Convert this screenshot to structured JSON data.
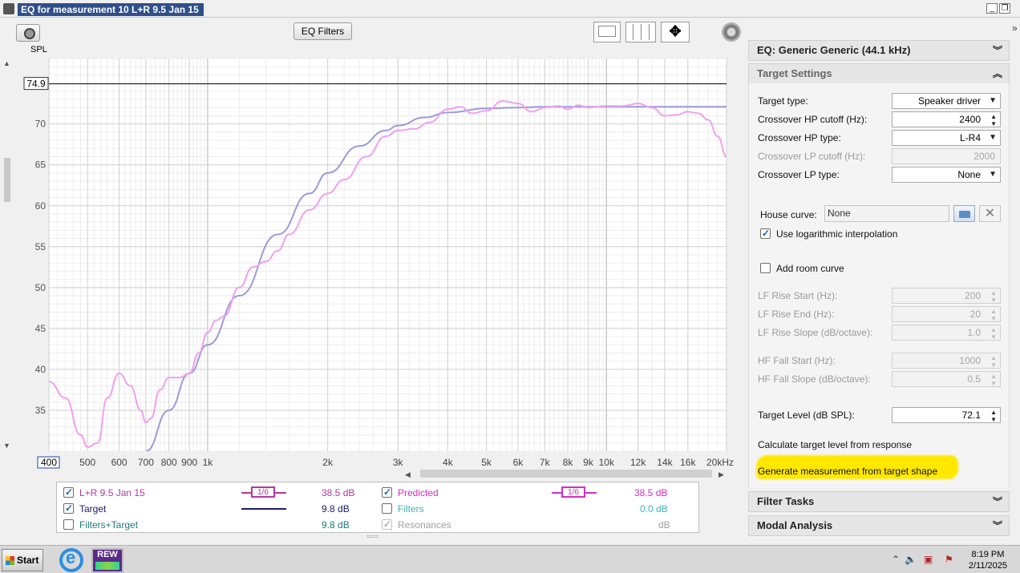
{
  "window": {
    "title": "EQ for measurement 10 L+R 9.5 Jan 15"
  },
  "toolbar": {
    "eq_filters_label": "EQ Filters"
  },
  "chart_data": {
    "type": "line",
    "xscale": "log",
    "xlim": [
      400,
      20000
    ],
    "ylim": [
      30,
      78
    ],
    "ylabel": "SPL",
    "level_marker": {
      "value": 74.9,
      "label": "74.9"
    },
    "x_ticks": [
      400,
      500,
      600,
      700,
      800,
      900,
      1000,
      2000,
      3000,
      4000,
      5000,
      6000,
      7000,
      8000,
      9000,
      10000,
      12000,
      14000,
      16000,
      20000
    ],
    "x_tick_labels": [
      "400",
      "500",
      "600",
      "700",
      "800",
      "900",
      "1k",
      "2k",
      "3k",
      "4k",
      "5k",
      "6k",
      "7k",
      "8k",
      "9k",
      "10k",
      "12k",
      "14k",
      "16k",
      "20kHz"
    ],
    "y_ticks": [
      35,
      40,
      45,
      50,
      55,
      60,
      65,
      70
    ],
    "y_tick_labels": [
      "35",
      "40",
      "45",
      "50",
      "55",
      "60",
      "65",
      "70"
    ],
    "series": [
      {
        "name": "Target",
        "color": "#9b9bd6",
        "x": [
          700,
          800,
          900,
          1000,
          1200,
          1500,
          1800,
          2000,
          2400,
          2800,
          3000,
          3500,
          4000,
          5000,
          6000,
          7000,
          8000,
          10000,
          12000,
          16000,
          20000
        ],
        "y": [
          30.0,
          35.0,
          39.5,
          43.0,
          49.0,
          56.5,
          61.5,
          64.0,
          67.3,
          69.2,
          69.8,
          70.8,
          71.4,
          71.9,
          72.0,
          72.1,
          72.1,
          72.1,
          72.1,
          72.1,
          72.1
        ]
      },
      {
        "name": "L+R 9.5 Jan 15",
        "color": "#f0a0ee",
        "x": [
          400,
          440,
          480,
          500,
          530,
          560,
          600,
          640,
          680,
          700,
          720,
          760,
          800,
          850,
          900,
          950,
          1000,
          1050,
          1100,
          1200,
          1300,
          1400,
          1500,
          1600,
          1800,
          2000,
          2200,
          2500,
          2800,
          3000,
          3300,
          3600,
          4000,
          4300,
          4600,
          5000,
          5500,
          6000,
          6500,
          7000,
          7600,
          8000,
          8500,
          9000,
          10000,
          11000,
          12000,
          13000,
          14000,
          15000,
          16000,
          17000,
          18000,
          19000,
          20000
        ],
        "y": [
          38.5,
          36.5,
          32.0,
          30.5,
          31.0,
          36.5,
          39.5,
          38.0,
          35.0,
          33.5,
          34.0,
          37.5,
          39.0,
          39.0,
          39.5,
          42.0,
          44.5,
          46.0,
          46.5,
          50.0,
          52.5,
          53.2,
          54.5,
          56.5,
          59.5,
          61.5,
          63.2,
          66.0,
          68.5,
          69.2,
          69.4,
          70.2,
          71.8,
          72.1,
          71.3,
          71.6,
          72.8,
          72.5,
          71.5,
          72.0,
          72.2,
          71.8,
          72.3,
          72.0,
          72.2,
          72.2,
          72.5,
          72.0,
          71.0,
          71.1,
          71.5,
          71.3,
          70.5,
          68.5,
          66.0
        ]
      }
    ]
  },
  "legend": {
    "rows": [
      {
        "label": "L+R 9.5 Jan 15",
        "checked": true,
        "smoothing": "1/6",
        "value": "38.5 dB"
      },
      {
        "label": "Target",
        "checked": true,
        "value": "9.8 dB"
      },
      {
        "label": "Filters+Target",
        "checked": false,
        "value": "9.8 dB"
      }
    ],
    "rows_right": [
      {
        "label": "Predicted",
        "checked": true,
        "smoothing": "1/6",
        "value": "38.5 dB"
      },
      {
        "label": "Filters",
        "checked": false,
        "value": "0.0 dB"
      },
      {
        "label": "Resonances",
        "checked": true,
        "value": "dB"
      }
    ]
  },
  "right_panel": {
    "eq_header": "EQ: Generic Generic (44.1 kHz)",
    "target_settings_header": "Target Settings",
    "target_type_label": "Target type:",
    "target_type_value": "Speaker driver",
    "hp_cutoff_label": "Crossover HP cutoff (Hz):",
    "hp_cutoff_value": "2400",
    "hp_type_label": "Crossover HP type:",
    "hp_type_value": "L-R4",
    "lp_cutoff_label": "Crossover LP cutoff (Hz):",
    "lp_cutoff_value": "2000",
    "lp_type_label": "Crossover LP type:",
    "lp_type_value": "None",
    "house_curve_label": "House curve:",
    "house_curve_value": "None",
    "log_interp_label": "Use logarithmic interpolation",
    "room_curve_label": "Add room curve",
    "lf_rise_start_label": "LF Rise Start (Hz):",
    "lf_rise_start_value": "200",
    "lf_rise_end_label": "LF Rise End (Hz):",
    "lf_rise_end_value": "20",
    "lf_rise_slope_label": "LF Rise Slope (dB/octave):",
    "lf_rise_slope_value": "1.0",
    "hf_fall_start_label": "HF Fall Start (Hz):",
    "hf_fall_start_value": "1000",
    "hf_fall_slope_label": "HF Fall Slope (dB/octave):",
    "hf_fall_slope_value": "0.5",
    "target_level_label": "Target Level (dB SPL):",
    "target_level_value": "72.1",
    "calc_target_label": "Calculate target level from response",
    "generate_label": "Generate measurement from target shape",
    "filter_tasks_header": "Filter Tasks",
    "modal_analysis_header": "Modal Analysis"
  },
  "taskbar": {
    "start_label": "Start",
    "rew_label": "REW",
    "time": "8:19 PM",
    "date": "2/11/2025"
  }
}
